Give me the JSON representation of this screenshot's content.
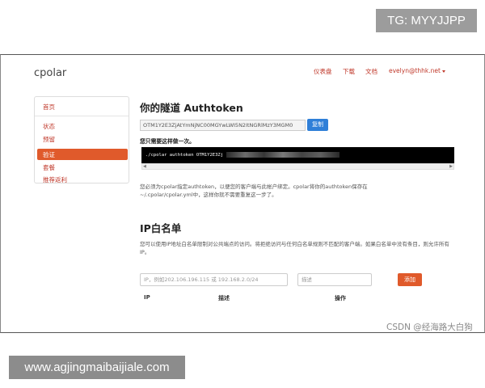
{
  "overlay": {
    "tg_label": "TG: MYYJJPP",
    "url_label": "www.agjingmaibaijiale.com",
    "watermark": "CSDN @经海路大白狗"
  },
  "header": {
    "logo": "cpolar",
    "nav": [
      "仪表盘",
      "下载",
      "文档"
    ],
    "user": "evelyn@thhk.net"
  },
  "sidebar": {
    "items": [
      {
        "label": "首页",
        "active": false
      },
      {
        "label": "状态",
        "active": false
      },
      {
        "label": "预留",
        "active": false
      },
      {
        "label": "验证",
        "active": true
      },
      {
        "label": "套餐",
        "active": false
      },
      {
        "label": "推荐返利",
        "active": false
      }
    ]
  },
  "authtoken": {
    "title": "你的隧道 Authtoken",
    "token_value": "OTM1Y2E3ZjAtYmNjNC00MGYwLWI5N2ItNGRlMzY3MGM0",
    "copy_label": "复制",
    "instruction": "您只需要这样做一次。",
    "command": "./cpolar authtoken OTM1Y2E3Zj",
    "description": "您必须为cpolar指定authtoken，以便您的客户端与此帐户绑定。cpolar将你的authtoken保存在~/.cpolar/cpolar.yml中，这样你就不需要重复这一步了。"
  },
  "ip_whitelist": {
    "title": "IP白名单",
    "description": "您可以使用IP地址白名单限制对公共端点的访问。将拒绝访问与任何白名单规则不匹配的客户端。如果白名单中没有条目，则允许所有IP。",
    "ip_placeholder": "IP，例如202.106.196.115 或 192.168.2.0/24",
    "desc_placeholder": "描述",
    "add_label": "添加",
    "columns": [
      "IP",
      "描述",
      "操作"
    ]
  }
}
